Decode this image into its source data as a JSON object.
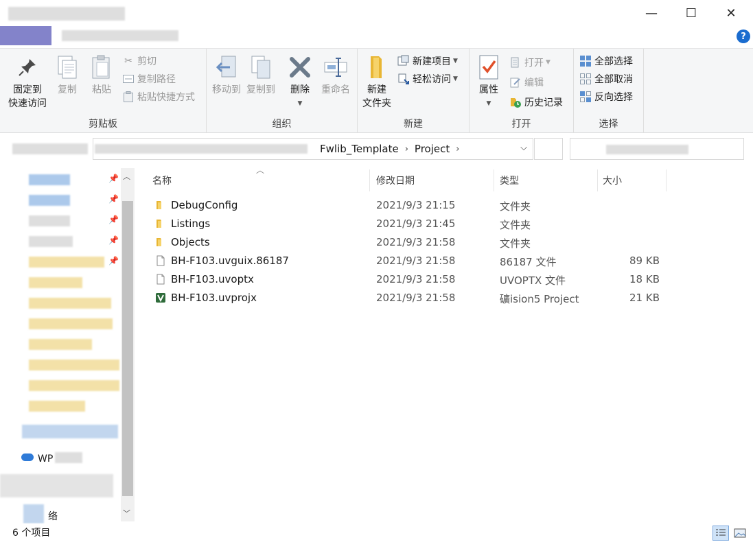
{
  "window": {
    "minimize": "—",
    "maximize": "☐",
    "close": "✕",
    "help": "?"
  },
  "ribbon": {
    "clipboard": {
      "label": "剪贴板",
      "pin_line1": "固定到",
      "pin_line2": "快速访问",
      "copy": "复制",
      "paste": "粘贴",
      "cut": "剪切",
      "copy_path": "复制路径",
      "paste_shortcut": "粘贴快捷方式"
    },
    "organize": {
      "label": "组织",
      "move_to": "移动到",
      "copy_to": "复制到",
      "delete": "删除",
      "rename": "重命名"
    },
    "new": {
      "label": "新建",
      "new_folder_line1": "新建",
      "new_folder_line2": "文件夹",
      "new_item": "新建项目",
      "easy_access": "轻松访问"
    },
    "open": {
      "label": "打开",
      "properties": "属性",
      "open": "打开",
      "edit": "编辑",
      "history": "历史记录"
    },
    "select": {
      "label": "选择",
      "select_all": "全部选择",
      "select_none": "全部取消",
      "invert": "反向选择"
    }
  },
  "address": {
    "crumbs": [
      "Fwlib_Template",
      "Project"
    ]
  },
  "nav": {
    "items": [
      {
        "label": "WP"
      },
      {
        "label": "络"
      }
    ]
  },
  "columns": {
    "name": "名称",
    "date": "修改日期",
    "type": "类型",
    "size": "大小"
  },
  "files": [
    {
      "name": "DebugConfig",
      "date": "2021/9/3 21:15",
      "type": "文件夹",
      "size": "",
      "icon": "folder-icon"
    },
    {
      "name": "Listings",
      "date": "2021/9/3 21:45",
      "type": "文件夹",
      "size": "",
      "icon": "folder-icon"
    },
    {
      "name": "Objects",
      "date": "2021/9/3 21:58",
      "type": "文件夹",
      "size": "",
      "icon": "folder-icon"
    },
    {
      "name": "BH-F103.uvguix.86187",
      "date": "2021/9/3 21:58",
      "type": "86187 文件",
      "size": "89 KB",
      "icon": "file-icon"
    },
    {
      "name": "BH-F103.uvoptx",
      "date": "2021/9/3 21:58",
      "type": "UVOPTX 文件",
      "size": "18 KB",
      "icon": "file-icon"
    },
    {
      "name": "BH-F103.uvprojx",
      "date": "2021/9/3 21:58",
      "type": "礦ision5 Project",
      "size": "21 KB",
      "icon": "keil-icon"
    }
  ],
  "status": {
    "count": "6 个项目"
  },
  "colors": {
    "accent": "#1a6ccf",
    "folder": "#e8b634",
    "ribbon_bg": "#f5f6f7"
  }
}
